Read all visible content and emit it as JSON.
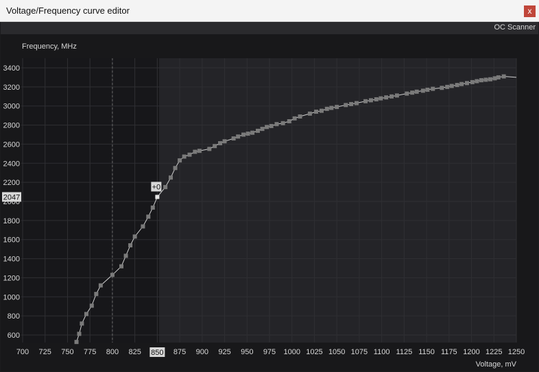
{
  "window": {
    "title": "Voltage/Frequency curve editor",
    "close_label": "x"
  },
  "menu": {
    "oc_scanner": "OC Scanner"
  },
  "colors": {
    "background": "#1c1c1e",
    "plot_left": "#17171a",
    "plot_right": "#242428",
    "points": "#7a7a7a",
    "selected_point": "#e6e6e6"
  },
  "chart_data": {
    "type": "line",
    "xlabel": "Voltage, mV",
    "ylabel": "Frequency, MHz",
    "xlim": [
      700,
      1250
    ],
    "ylim": [
      500,
      3450
    ],
    "x_ticks": [
      700,
      725,
      750,
      775,
      800,
      825,
      850,
      875,
      900,
      925,
      950,
      975,
      1000,
      1025,
      1050,
      1075,
      1100,
      1125,
      1150,
      1175,
      1200,
      1225,
      1250
    ],
    "y_ticks": [
      600,
      800,
      1000,
      1200,
      1400,
      1600,
      1800,
      2000,
      2200,
      2400,
      2600,
      2800,
      3000,
      3200,
      3400
    ],
    "selected": {
      "voltage": 850,
      "voltage_label": "850",
      "frequency_label": "2047",
      "offset_label": "+0"
    },
    "dashed_reference_voltage": 800,
    "points": [
      [
        760,
        527
      ],
      [
        763,
        612
      ],
      [
        766,
        720
      ],
      [
        771,
        820
      ],
      [
        777,
        907
      ],
      [
        782,
        1030
      ],
      [
        787,
        1120
      ],
      [
        800,
        1230
      ],
      [
        810,
        1320
      ],
      [
        815,
        1430
      ],
      [
        820,
        1540
      ],
      [
        825,
        1632
      ],
      [
        834,
        1738
      ],
      [
        840,
        1840
      ],
      [
        845,
        1935
      ],
      [
        850,
        2047
      ],
      [
        859,
        2150
      ],
      [
        865,
        2250
      ],
      [
        870,
        2350
      ],
      [
        875,
        2430
      ],
      [
        880,
        2470
      ],
      [
        886,
        2490
      ],
      [
        892,
        2520
      ],
      [
        897,
        2530
      ],
      [
        908,
        2550
      ],
      [
        914,
        2580
      ],
      [
        920,
        2610
      ],
      [
        925,
        2630
      ],
      [
        935,
        2660
      ],
      [
        940,
        2680
      ],
      [
        946,
        2700
      ],
      [
        951,
        2710
      ],
      [
        956,
        2720
      ],
      [
        962,
        2740
      ],
      [
        967,
        2760
      ],
      [
        972,
        2780
      ],
      [
        977,
        2790
      ],
      [
        983,
        2810
      ],
      [
        990,
        2820
      ],
      [
        997,
        2840
      ],
      [
        1003,
        2870
      ],
      [
        1009,
        2890
      ],
      [
        1020,
        2920
      ],
      [
        1027,
        2940
      ],
      [
        1033,
        2950
      ],
      [
        1039,
        2970
      ],
      [
        1044,
        2980
      ],
      [
        1050,
        2990
      ],
      [
        1060,
        3010
      ],
      [
        1066,
        3020
      ],
      [
        1072,
        3030
      ],
      [
        1082,
        3050
      ],
      [
        1088,
        3060
      ],
      [
        1094,
        3070
      ],
      [
        1099,
        3080
      ],
      [
        1105,
        3090
      ],
      [
        1111,
        3100
      ],
      [
        1117,
        3110
      ],
      [
        1128,
        3130
      ],
      [
        1134,
        3140
      ],
      [
        1139,
        3150
      ],
      [
        1146,
        3160
      ],
      [
        1151,
        3170
      ],
      [
        1157,
        3180
      ],
      [
        1167,
        3190
      ],
      [
        1173,
        3200
      ],
      [
        1178,
        3210
      ],
      [
        1184,
        3220
      ],
      [
        1189,
        3230
      ],
      [
        1195,
        3240
      ],
      [
        1201,
        3250
      ],
      [
        1206,
        3260
      ],
      [
        1211,
        3270
      ],
      [
        1216,
        3275
      ],
      [
        1221,
        3280
      ],
      [
        1226,
        3290
      ],
      [
        1230,
        3300
      ],
      [
        1236,
        3310
      ]
    ],
    "curve_end": [
      1250,
      3300
    ]
  }
}
